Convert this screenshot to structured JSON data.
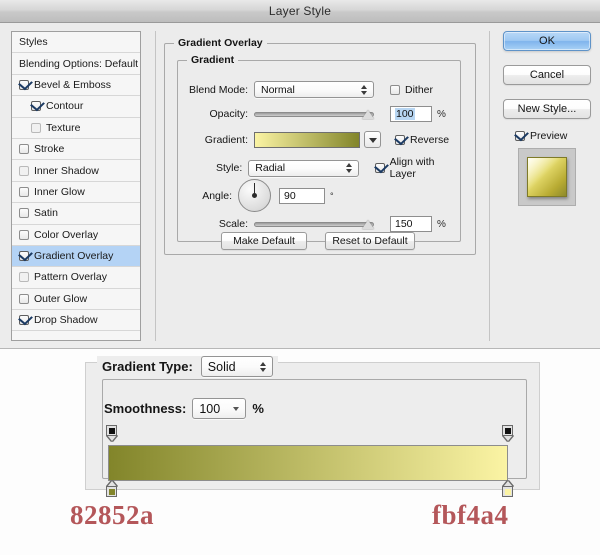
{
  "window": {
    "title": "Layer Style"
  },
  "styles_panel": {
    "items": [
      {
        "label": "Styles",
        "checkbox": "none",
        "indent": false,
        "selected": false
      },
      {
        "label": "Blending Options: Default",
        "checkbox": "none",
        "indent": false,
        "selected": false
      },
      {
        "label": "Bevel & Emboss",
        "checkbox": "checked",
        "indent": false,
        "selected": false
      },
      {
        "label": "Contour",
        "checkbox": "checked",
        "indent": true,
        "selected": false
      },
      {
        "label": "Texture",
        "checkbox": "dim",
        "indent": true,
        "selected": false
      },
      {
        "label": "Stroke",
        "checkbox": "empty",
        "indent": false,
        "selected": false
      },
      {
        "label": "Inner Shadow",
        "checkbox": "dim",
        "indent": false,
        "selected": false
      },
      {
        "label": "Inner Glow",
        "checkbox": "empty",
        "indent": false,
        "selected": false
      },
      {
        "label": "Satin",
        "checkbox": "empty",
        "indent": false,
        "selected": false
      },
      {
        "label": "Color Overlay",
        "checkbox": "empty",
        "indent": false,
        "selected": false
      },
      {
        "label": "Gradient Overlay",
        "checkbox": "checked",
        "indent": false,
        "selected": true
      },
      {
        "label": "Pattern Overlay",
        "checkbox": "dim",
        "indent": false,
        "selected": false
      },
      {
        "label": "Outer Glow",
        "checkbox": "empty",
        "indent": false,
        "selected": false
      },
      {
        "label": "Drop Shadow",
        "checkbox": "checked",
        "indent": false,
        "selected": false
      }
    ]
  },
  "overlay": {
    "group_title": "Gradient Overlay",
    "subgroup_title": "Gradient",
    "blend_mode": {
      "label": "Blend Mode:",
      "value": "Normal"
    },
    "dither": {
      "label": "Dither",
      "checked": false
    },
    "opacity": {
      "label": "Opacity:",
      "value": "100",
      "unit": "%",
      "slider_percent": 100
    },
    "gradient": {
      "label": "Gradient:",
      "from": "#fbf4a4",
      "to": "#82852a"
    },
    "reverse": {
      "label": "Reverse",
      "checked": true
    },
    "style": {
      "label": "Style:",
      "value": "Radial"
    },
    "align_with_layer": {
      "label": "Align with Layer",
      "checked": true
    },
    "angle": {
      "label": "Angle:",
      "value": "90",
      "unit": "°"
    },
    "scale": {
      "label": "Scale:",
      "value": "150",
      "unit": "%",
      "slider_percent": 100
    },
    "make_default": "Make Default",
    "reset_to_default": "Reset to Default"
  },
  "buttons": {
    "ok": "OK",
    "cancel": "Cancel",
    "new_style": "New Style...",
    "preview": {
      "label": "Preview",
      "checked": true
    }
  },
  "gradient_editor": {
    "gradient_type": {
      "label": "Gradient Type:",
      "value": "Solid"
    },
    "smoothness": {
      "label": "Smoothness:",
      "value": "100",
      "unit": "%"
    },
    "bar": {
      "from": "#82852a",
      "to": "#fbf4a4"
    },
    "opacity_stops": [
      {
        "position_percent": 0,
        "color": "#111111"
      },
      {
        "position_percent": 100,
        "color": "#111111"
      }
    ],
    "color_stops": [
      {
        "position_percent": 0,
        "color": "#82852a"
      },
      {
        "position_percent": 100,
        "color": "#fbf4a4"
      }
    ]
  },
  "hex_labels": {
    "left": "82852a",
    "right": "fbf4a4",
    "text_color": "#b4575a"
  }
}
